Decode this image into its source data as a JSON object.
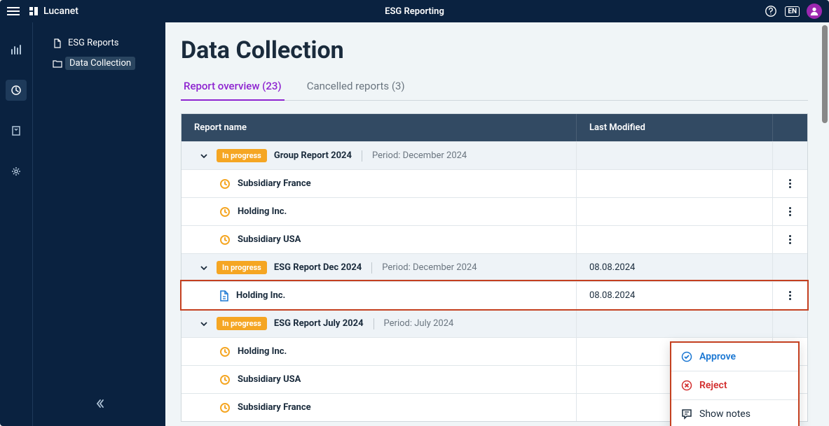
{
  "header": {
    "brand": "Lucanet",
    "app_title": "ESG Reporting",
    "lang": "EN"
  },
  "sidebar": {
    "items": [
      {
        "label": "ESG Reports"
      },
      {
        "label": "Data Collection"
      }
    ]
  },
  "page": {
    "title": "Data Collection"
  },
  "tabs": [
    {
      "label": "Report overview (23)"
    },
    {
      "label": "Cancelled reports (3)"
    }
  ],
  "table": {
    "headers": {
      "name": "Report name",
      "modified": "Last Modified"
    },
    "rows": [
      {
        "type": "parent",
        "badge": "In progress",
        "name": "Group Report 2024",
        "period": "Period: December 2024",
        "modified": ""
      },
      {
        "type": "child",
        "name": "Subsidiary France",
        "modified": ""
      },
      {
        "type": "child",
        "name": "Holding Inc.",
        "modified": ""
      },
      {
        "type": "child",
        "name": "Subsidiary USA",
        "modified": ""
      },
      {
        "type": "parent",
        "badge": "In progress",
        "name": "ESG Report Dec 2024",
        "period": "Period: December 2024",
        "modified": "08.08.2024"
      },
      {
        "type": "child-doc",
        "name": "Holding Inc.",
        "modified": "08.08.2024"
      },
      {
        "type": "parent",
        "badge": "In progress",
        "name": "ESG Report July 2024",
        "period": "Period: July 2024",
        "modified": ""
      },
      {
        "type": "child",
        "name": "Holding Inc.",
        "modified": ""
      },
      {
        "type": "child",
        "name": "Subsidiary USA",
        "modified": ""
      },
      {
        "type": "child",
        "name": "Subsidiary France",
        "modified": ""
      }
    ]
  },
  "menu": {
    "approve": "Approve",
    "reject": "Reject",
    "show_notes": "Show notes"
  }
}
